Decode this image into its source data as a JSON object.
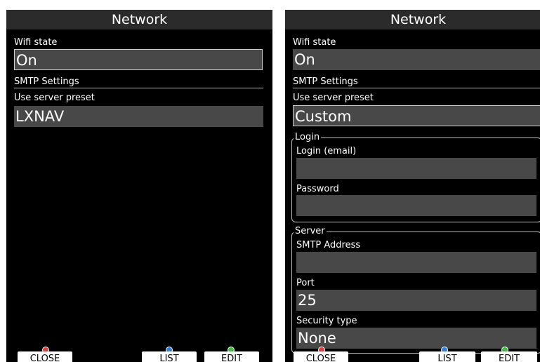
{
  "left": {
    "title": "Network",
    "wifi_label": "Wifi state",
    "wifi_value": "On",
    "smtp_label": "SMTP Settings",
    "preset_label": "Use server preset",
    "preset_value": "LXNAV"
  },
  "right": {
    "title": "Network",
    "wifi_label": "Wifi state",
    "wifi_value": "On",
    "smtp_label": "SMTP Settings",
    "preset_label": "Use server preset",
    "preset_value": "Custom",
    "login_group": "Login",
    "login_email_label": "Login (email)",
    "login_email_value": "",
    "password_label": "Password",
    "password_value": "",
    "server_group": "Server",
    "smtp_address_label": "SMTP Address",
    "smtp_address_value": "",
    "port_label": "Port",
    "port_value": "25",
    "security_label": "Security type",
    "security_value": "None"
  },
  "buttons": {
    "close": "CLOSE",
    "list": "LIST",
    "edit": "EDIT"
  },
  "colors": {
    "screen_bg": "#000000",
    "field_bg": "#484848",
    "close_indicator": "#e23b3b",
    "list_indicator": "#2f7fe0",
    "edit_indicator": "#3fbf3f"
  }
}
